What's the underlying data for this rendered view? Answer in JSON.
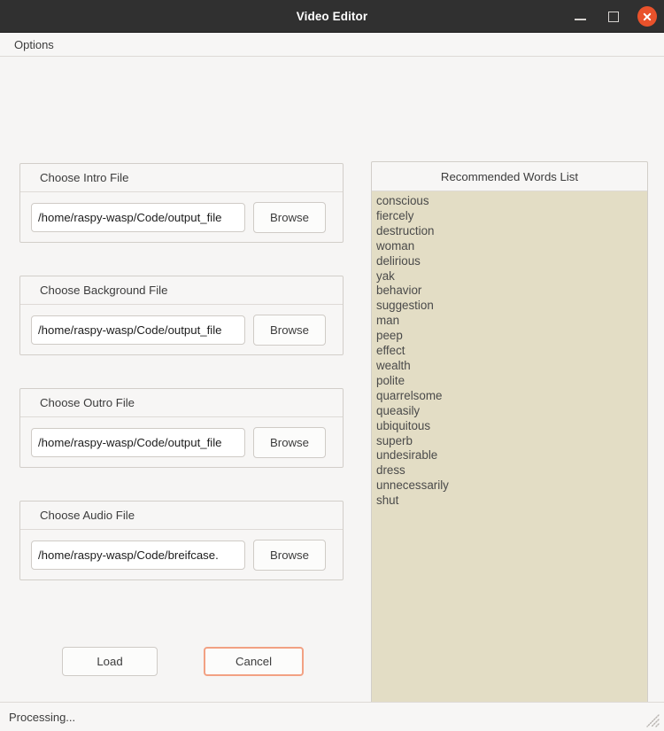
{
  "window": {
    "title": "Video Editor",
    "controls": {
      "minimize": "minimize",
      "maximize": "maximize",
      "close": "close"
    }
  },
  "menubar": {
    "items": [
      {
        "label": "Options"
      }
    ]
  },
  "file_groups": [
    {
      "title": "Choose Intro File",
      "path_value": "/home/raspy-wasp/Code/output_file",
      "browse_label": "Browse"
    },
    {
      "title": "Choose Background File",
      "path_value": "/home/raspy-wasp/Code/output_file",
      "browse_label": "Browse"
    },
    {
      "title": "Choose Outro File",
      "path_value": "/home/raspy-wasp/Code/output_file",
      "browse_label": "Browse"
    },
    {
      "title": "Choose Audio File",
      "path_value": "/home/raspy-wasp/Code/breifcase.",
      "browse_label": "Browse"
    }
  ],
  "actions": {
    "load_label": "Load",
    "cancel_label": "Cancel"
  },
  "progress": {
    "indeterminate": true,
    "chunk_start_percent": 54.5,
    "chunk_width_percent": 21,
    "chunk_color": "#8f3f8f",
    "track_color": "#d8d4d0"
  },
  "words_panel": {
    "title": "Recommended Words List",
    "background_color": "#e3ddc5",
    "items": [
      "conscious",
      "fiercely",
      "destruction",
      "woman",
      "delirious",
      "yak",
      "behavior",
      "suggestion",
      "man",
      "peep",
      "effect",
      "wealth",
      "polite",
      "quarrelsome",
      "queasily",
      "ubiquitous",
      "superb",
      "undesirable",
      "dress",
      "unnecessarily",
      "shut"
    ]
  },
  "statusbar": {
    "text": "Processing..."
  },
  "theme": {
    "titlebar_bg": "#303030",
    "close_button_bg": "#e9522b",
    "focus_border": "#f2a183",
    "window_bg": "#f6f5f4"
  }
}
